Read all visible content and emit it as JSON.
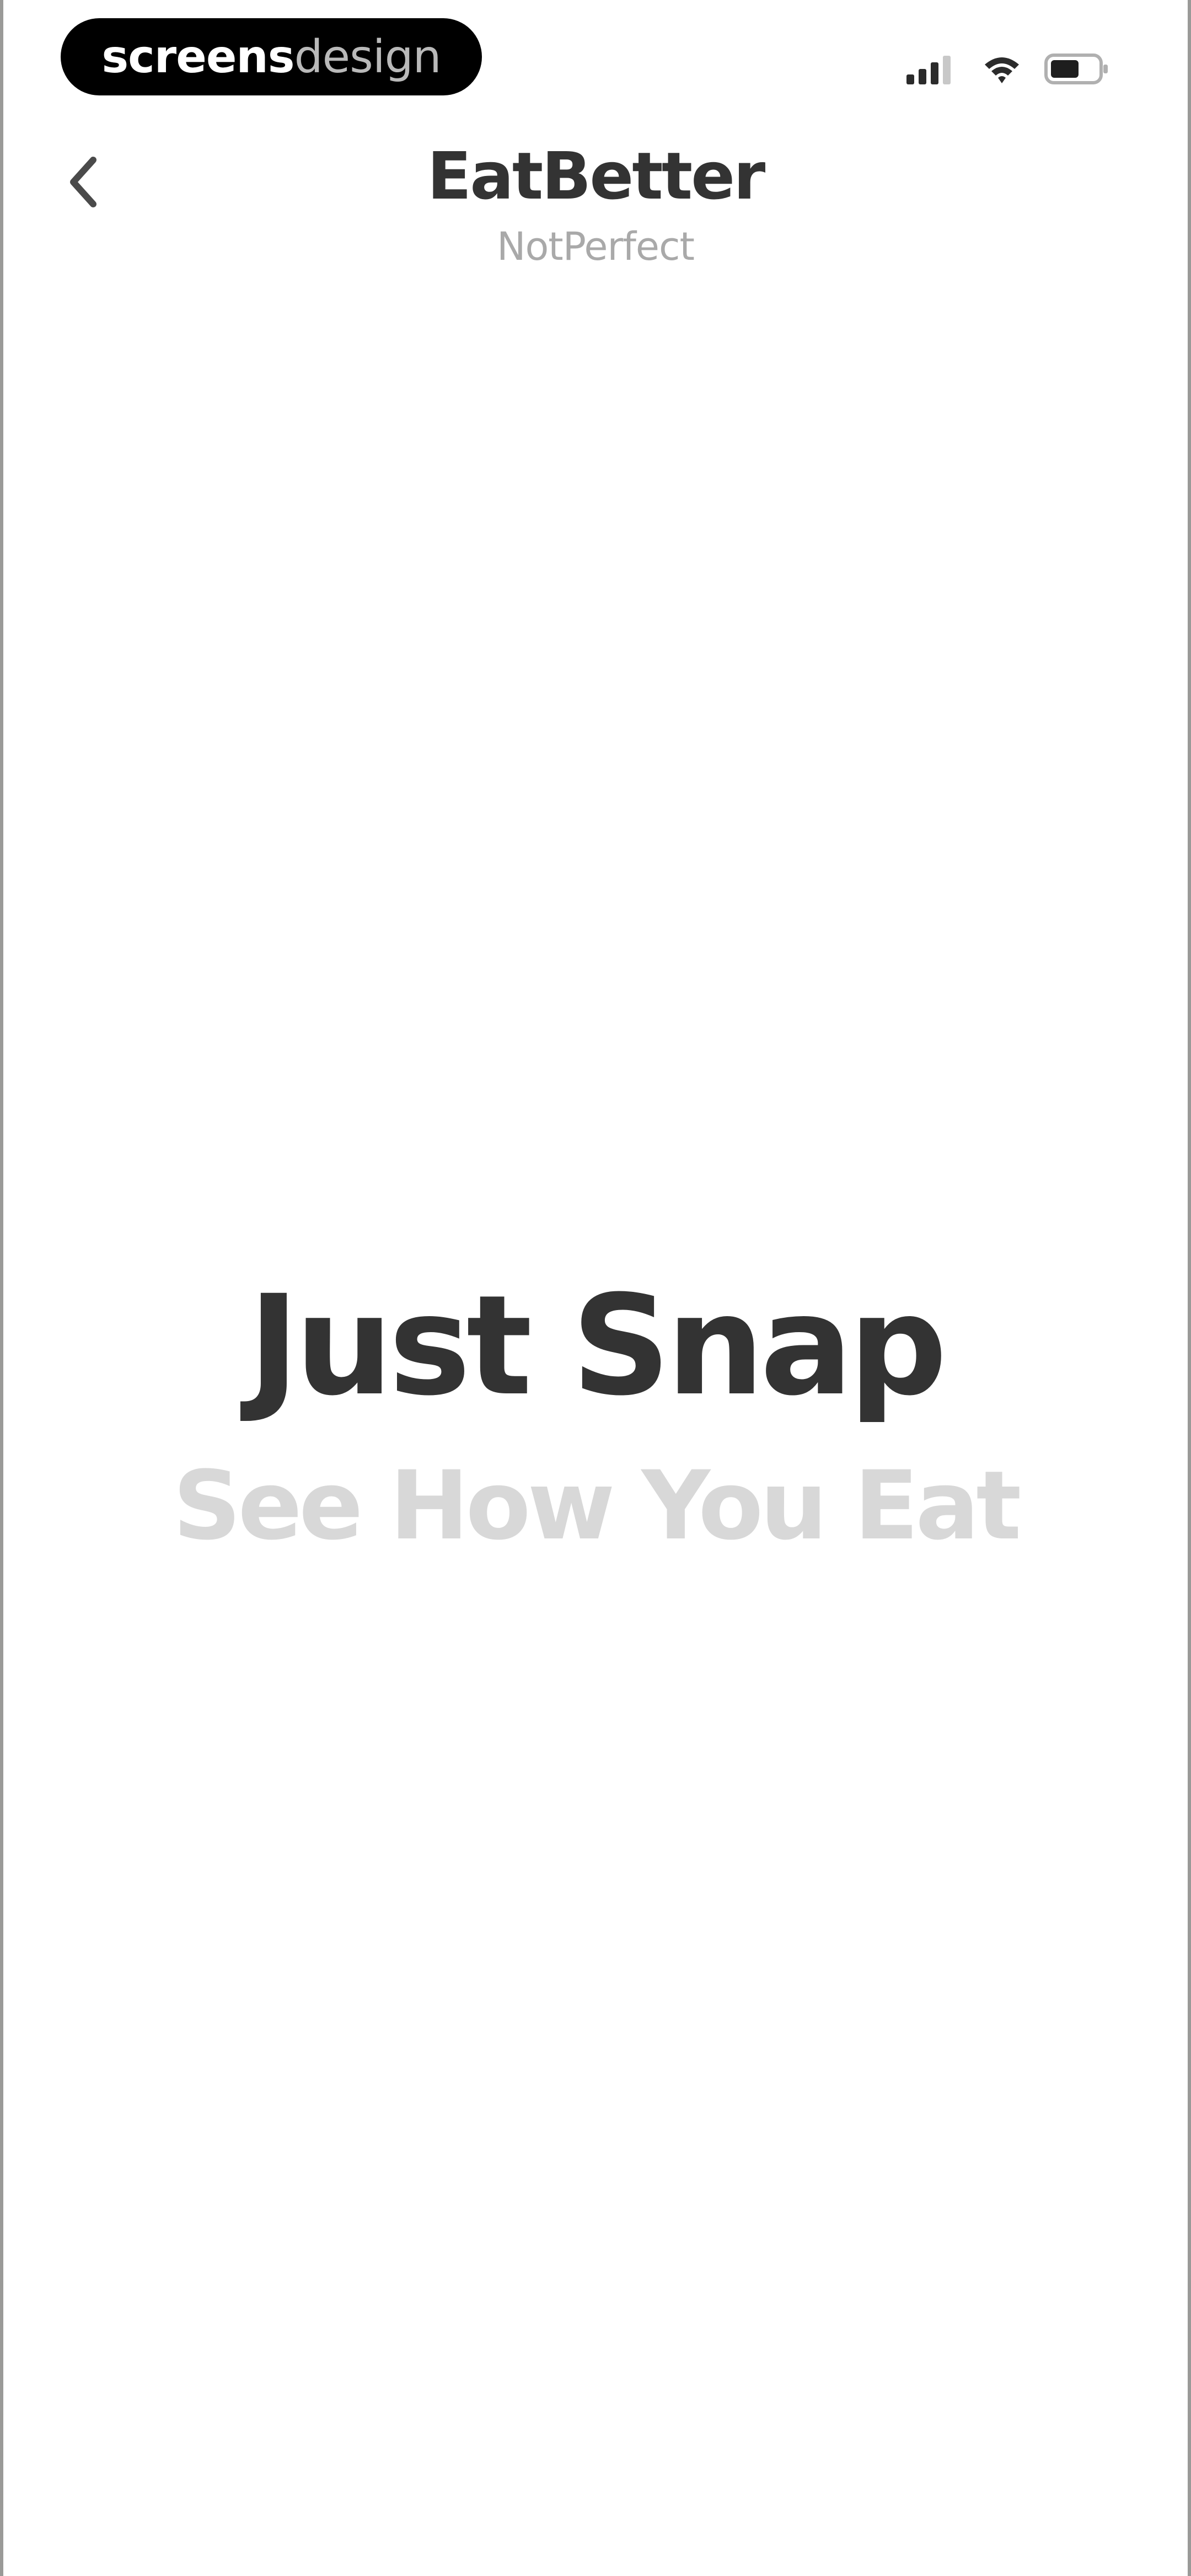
{
  "status_bar": {
    "brand_part1": "screens",
    "brand_part2": "design",
    "signal_icon": "cellular-signal-icon",
    "wifi_icon": "wifi-icon",
    "battery_icon": "battery-icon"
  },
  "header": {
    "back_icon": "chevron-left-icon",
    "title": "EatBetter",
    "subtitle": "NotPerfect"
  },
  "hero": {
    "title": "Just Snap",
    "subtitle": "See How You Eat"
  },
  "colors": {
    "text_dark": "#333333",
    "text_muted": "#a9a9a9",
    "text_light": "#d8d8d8",
    "background": "#ffffff"
  }
}
